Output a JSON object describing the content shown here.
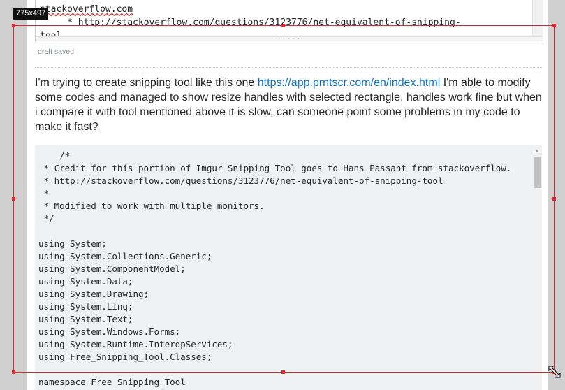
{
  "selection": {
    "size_label": "775x497",
    "accent": "#e0242b"
  },
  "editor": {
    "top_line_1": "stackoverflow.com",
    "top_line_2": "     * http://stackoverflow.com/questions/3123776/net-equivalent-of-snipping-",
    "top_line_3": "tool",
    "grip": "· · · · ·"
  },
  "status": {
    "draft": "draft saved"
  },
  "question": {
    "text_before_link": "I'm trying to create snipping tool like this one ",
    "link_text": "https://app.prntscr.com/en/index.html",
    "text_after_link": " I'm able to modify some codes and managed to show resize handles with selected rectangle, handles work fine but when i compare it with tool mentioned above it is slow, can someone point some problems in my code to make it fast?"
  },
  "code": {
    "lines": [
      "    /*",
      " * Credit for this portion of Imgur Snipping Tool goes to Hans Passant from stackoverflow.",
      " * http://stackoverflow.com/questions/3123776/net-equivalent-of-snipping-tool",
      " *",
      " * Modified to work with multiple monitors.",
      " */",
      "",
      "using System;",
      "using System.Collections.Generic;",
      "using System.ComponentModel;",
      "using System.Data;",
      "using System.Drawing;",
      "using System.Linq;",
      "using System.Text;",
      "using System.Windows.Forms;",
      "using System.Runtime.InteropServices;",
      "using Free_Snipping_Tool.Classes;",
      "",
      "namespace Free_Snipping_Tool"
    ]
  }
}
